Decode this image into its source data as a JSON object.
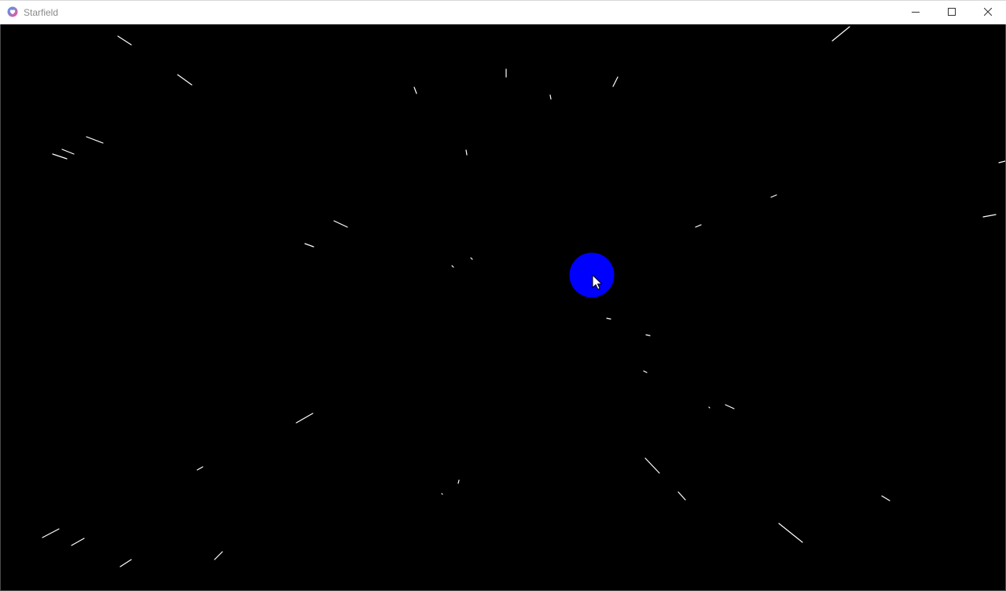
{
  "window": {
    "title": "Starfield",
    "icon": "heart-badge-icon",
    "controls": {
      "minimize_icon": "minimize-icon",
      "maximize_icon": "maximize-icon",
      "close_icon": "close-icon"
    }
  },
  "scene": {
    "background_color": "#000000",
    "star_color": "#ffffff",
    "orb_color": "#0000ff",
    "cursor_icon": "arrow-cursor-icon"
  }
}
